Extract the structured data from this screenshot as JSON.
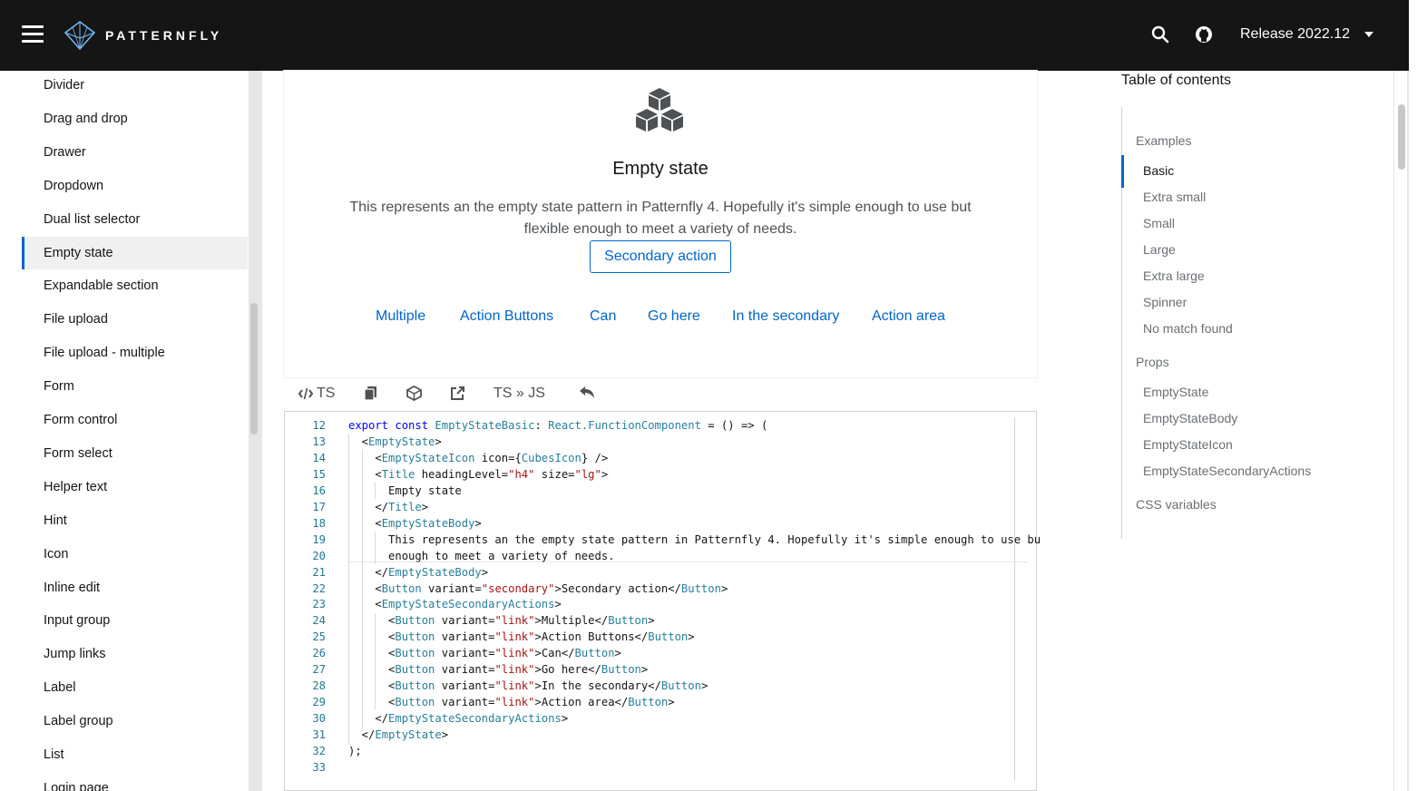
{
  "header": {
    "logo_text": "PATTERNFLY",
    "release_label": "Release 2022.12"
  },
  "sidebar": {
    "items": [
      {
        "label": "Divider"
      },
      {
        "label": "Drag and drop"
      },
      {
        "label": "Drawer"
      },
      {
        "label": "Dropdown"
      },
      {
        "label": "Dual list selector"
      },
      {
        "label": "Empty state",
        "active": true
      },
      {
        "label": "Expandable section"
      },
      {
        "label": "File upload"
      },
      {
        "label": "File upload - multiple"
      },
      {
        "label": "Form"
      },
      {
        "label": "Form control"
      },
      {
        "label": "Form select"
      },
      {
        "label": "Helper text"
      },
      {
        "label": "Hint"
      },
      {
        "label": "Icon"
      },
      {
        "label": "Inline edit"
      },
      {
        "label": "Input group"
      },
      {
        "label": "Jump links"
      },
      {
        "label": "Label"
      },
      {
        "label": "Label group"
      },
      {
        "label": "List"
      },
      {
        "label": "Login page"
      }
    ]
  },
  "example": {
    "title": "Empty state",
    "body": "This represents an the empty state pattern in Patternfly 4. Hopefully it's simple enough to use but flexible enough to meet a variety of needs.",
    "secondary_action": "Secondary action",
    "links": [
      "Multiple",
      "Action Buttons",
      "Can",
      "Go here",
      "In the secondary",
      "Action area"
    ]
  },
  "code_toolbar": {
    "ts_label": "TS",
    "convert_label": "TS » JS"
  },
  "code": {
    "lines": [
      {
        "n": "12",
        "text": "export const EmptyStateBasic: React.FunctionComponent = () => ("
      },
      {
        "n": "13",
        "text": "  <EmptyState>"
      },
      {
        "n": "14",
        "text": "    <EmptyStateIcon icon={CubesIcon} />"
      },
      {
        "n": "15",
        "text": "    <Title headingLevel=\"h4\" size=\"lg\">"
      },
      {
        "n": "16",
        "text": "      Empty state"
      },
      {
        "n": "17",
        "text": "    </Title>"
      },
      {
        "n": "18",
        "text": "    <EmptyStateBody>"
      },
      {
        "n": "19",
        "text": "      This represents an the empty state pattern in Patternfly 4. Hopefully it's simple enough to use bu"
      },
      {
        "n": "20",
        "text": "      enough to meet a variety of needs."
      },
      {
        "n": "21",
        "text": "    </EmptyStateBody>"
      },
      {
        "n": "22",
        "text": "    <Button variant=\"secondary\">Secondary action</Button>"
      },
      {
        "n": "23",
        "text": "    <EmptyStateSecondaryActions>"
      },
      {
        "n": "24",
        "text": "      <Button variant=\"link\">Multiple</Button>"
      },
      {
        "n": "25",
        "text": "      <Button variant=\"link\">Action Buttons</Button>"
      },
      {
        "n": "26",
        "text": "      <Button variant=\"link\">Can</Button>"
      },
      {
        "n": "27",
        "text": "      <Button variant=\"link\">Go here</Button>"
      },
      {
        "n": "28",
        "text": "      <Button variant=\"link\">In the secondary</Button>"
      },
      {
        "n": "29",
        "text": "      <Button variant=\"link\">Action area</Button>"
      },
      {
        "n": "30",
        "text": "    </EmptyStateSecondaryActions>"
      },
      {
        "n": "31",
        "text": "  </EmptyState>"
      },
      {
        "n": "32",
        "text": ");"
      },
      {
        "n": "33",
        "text": ""
      }
    ]
  },
  "toc": {
    "title": "Table of contents",
    "sections": [
      {
        "label": "Examples",
        "items": [
          "Basic",
          "Extra small",
          "Small",
          "Large",
          "Extra large",
          "Spinner",
          "No match found"
        ],
        "active": "Basic"
      },
      {
        "label": "Props",
        "items": [
          "EmptyState",
          "EmptyStateBody",
          "EmptyStateIcon",
          "EmptyStateSecondaryActions"
        ]
      },
      {
        "label": "CSS variables",
        "items": []
      }
    ]
  },
  "colors": {
    "accent": "#0066cc",
    "topbar": "#151515"
  }
}
